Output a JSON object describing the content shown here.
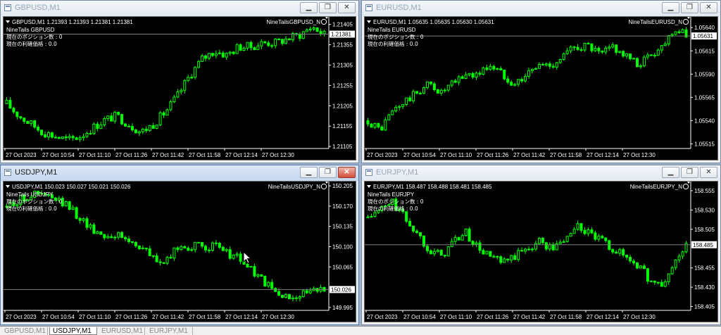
{
  "windows": [
    {
      "title": "GBPUSD,M1",
      "active": false,
      "buttons": {
        "minimize": "▁",
        "restore": "❐",
        "close": "✕"
      },
      "chart_data": {
        "type": "candlestick",
        "header": "GBPUSD,M1  1.21393 1.21393 1.21381 1.21381",
        "indicator_name": "NineTails GBPUSD",
        "info_lines": [
          "現在のポジション数 : 0",
          "現在の利確価格 : 0.0"
        ],
        "ea_label": "NineTailsGBPUSD_N",
        "price_ticks": [
          "1.21405",
          "1.21381",
          "1.21355",
          "1.21305",
          "1.21255",
          "1.21205",
          "1.21155",
          "1.21105"
        ],
        "time_labels": [
          "27 Oct 2023",
          "27 Oct 10:54",
          "27 Oct 11:10",
          "27 Oct 11:26",
          "27 Oct 11:42",
          "27 Oct 11:58",
          "27 Oct 12:14",
          "27 Oct 12:30"
        ],
        "current_price": "1.21381",
        "ylim": [
          1.211,
          1.2142
        ],
        "close_path": [
          1.2121,
          1.2118,
          1.2116,
          1.2114,
          1.2113,
          1.2112,
          1.2113,
          1.2115,
          1.2117,
          1.2118,
          1.2116,
          1.2114,
          1.2116,
          1.2119,
          1.2123,
          1.2128,
          1.2132,
          1.2134,
          1.2133,
          1.2135,
          1.2135,
          1.2136,
          1.2136,
          1.2137,
          1.2138,
          1.214,
          1.2138
        ]
      }
    },
    {
      "title": "EURUSD,M1",
      "active": false,
      "buttons": {
        "minimize": "▁",
        "restore": "❐",
        "close": "✕"
      },
      "chart_data": {
        "type": "candlestick",
        "header": "EURUSD,M1  1.05635 1.05635 1.05630 1.05631",
        "indicator_name": "NineTails EURUSD",
        "info_lines": [
          "現在のポジション数 : 0",
          "現在の利確価格 : 0.0"
        ],
        "ea_label": "NineTailsEURUSD_N",
        "price_ticks": [
          "1.05640",
          "1.05631",
          "1.05615",
          "1.05590",
          "1.05565",
          "1.05540",
          "1.05515"
        ],
        "time_labels": [
          "27 Oct 2023",
          "27 Oct 10:54",
          "27 Oct 11:10",
          "27 Oct 11:26",
          "27 Oct 11:42",
          "27 Oct 11:58",
          "27 Oct 12:14",
          "27 Oct 12:30"
        ],
        "current_price": "1.05631",
        "ylim": [
          1.0551,
          1.0565
        ],
        "close_path": [
          1.0554,
          1.0553,
          1.0555,
          1.0556,
          1.0557,
          1.0558,
          1.0557,
          1.0558,
          1.0559,
          1.0559,
          1.056,
          1.0559,
          1.0558,
          1.0559,
          1.056,
          1.056,
          1.0561,
          1.0562,
          1.0562,
          1.0561,
          1.0562,
          1.0561,
          1.056,
          1.0561,
          1.0562,
          1.0564,
          1.0563
        ]
      }
    },
    {
      "title": "USDJPY,M1",
      "active": true,
      "buttons": {
        "minimize": "▁",
        "restore": "❐",
        "close": "✕"
      },
      "chart_data": {
        "type": "candlestick",
        "header": "USDJPY,M1  150.023 150.027 150.021 150.026",
        "indicator_name": "NineTails USDJPY",
        "info_lines": [
          "現在のポジション数 : 0",
          "現在の利確価格 : 0.0"
        ],
        "ea_label": "NineTailsUSDJPY_N",
        "price_ticks": [
          "150.205",
          "150.170",
          "150.135",
          "150.100",
          "150.065",
          "150.026",
          "149.995"
        ],
        "time_labels": [
          "27 Oct 2023",
          "27 Oct 10:54",
          "27 Oct 11:10",
          "27 Oct 11:26",
          "27 Oct 11:42",
          "27 Oct 11:58",
          "27 Oct 12:14",
          "27 Oct 12:30"
        ],
        "current_price": "150.026",
        "ylim": [
          149.99,
          150.21
        ],
        "close_path": [
          150.17,
          150.18,
          150.19,
          150.19,
          150.18,
          150.17,
          150.15,
          150.13,
          150.12,
          150.12,
          150.11,
          150.1,
          150.08,
          150.07,
          150.1,
          150.1,
          150.1,
          150.1,
          150.09,
          150.08,
          150.06,
          150.04,
          150.02,
          150.01,
          150.02,
          150.02,
          150.03
        ]
      }
    },
    {
      "title": "EURJPY,M1",
      "active": false,
      "buttons": {
        "minimize": "▁",
        "restore": "❐",
        "close": "✕"
      },
      "chart_data": {
        "type": "candlestick",
        "header": "EURJPY,M1  158.487 158.488 158.481 158.485",
        "indicator_name": "NineTails EURJPY",
        "info_lines": [
          "現在のポジション数 : 0",
          "現在の利確価格 : 0.0"
        ],
        "ea_label": "NineTailsEURJPY_N",
        "price_ticks": [
          "158.555",
          "158.530",
          "158.505",
          "158.485",
          "158.455",
          "158.430",
          "158.405"
        ],
        "time_labels": [
          "27 Oct 2023",
          "27 Oct 10:54",
          "27 Oct 11:10",
          "27 Oct 11:26",
          "27 Oct 11:42",
          "27 Oct 11:58",
          "27 Oct 12:14",
          "27 Oct 12:30"
        ],
        "current_price": "158.485",
        "ylim": [
          158.4,
          158.565
        ],
        "close_path": [
          158.52,
          158.53,
          158.54,
          158.52,
          158.5,
          158.48,
          158.47,
          158.49,
          158.5,
          158.48,
          158.47,
          158.46,
          158.47,
          158.48,
          158.49,
          158.48,
          158.49,
          158.51,
          158.5,
          158.49,
          158.48,
          158.47,
          158.46,
          158.44,
          158.43,
          158.46,
          158.485
        ]
      }
    }
  ],
  "tabs": [
    "GBPUSD,M1",
    "USDJPY,M1",
    "EURUSD,M1",
    "EURJPY,M1"
  ],
  "active_tab": 1,
  "colors": {
    "candle": "#00ff00",
    "background": "#000000",
    "axis_text": "#ffffff",
    "price_line": "#808080"
  }
}
